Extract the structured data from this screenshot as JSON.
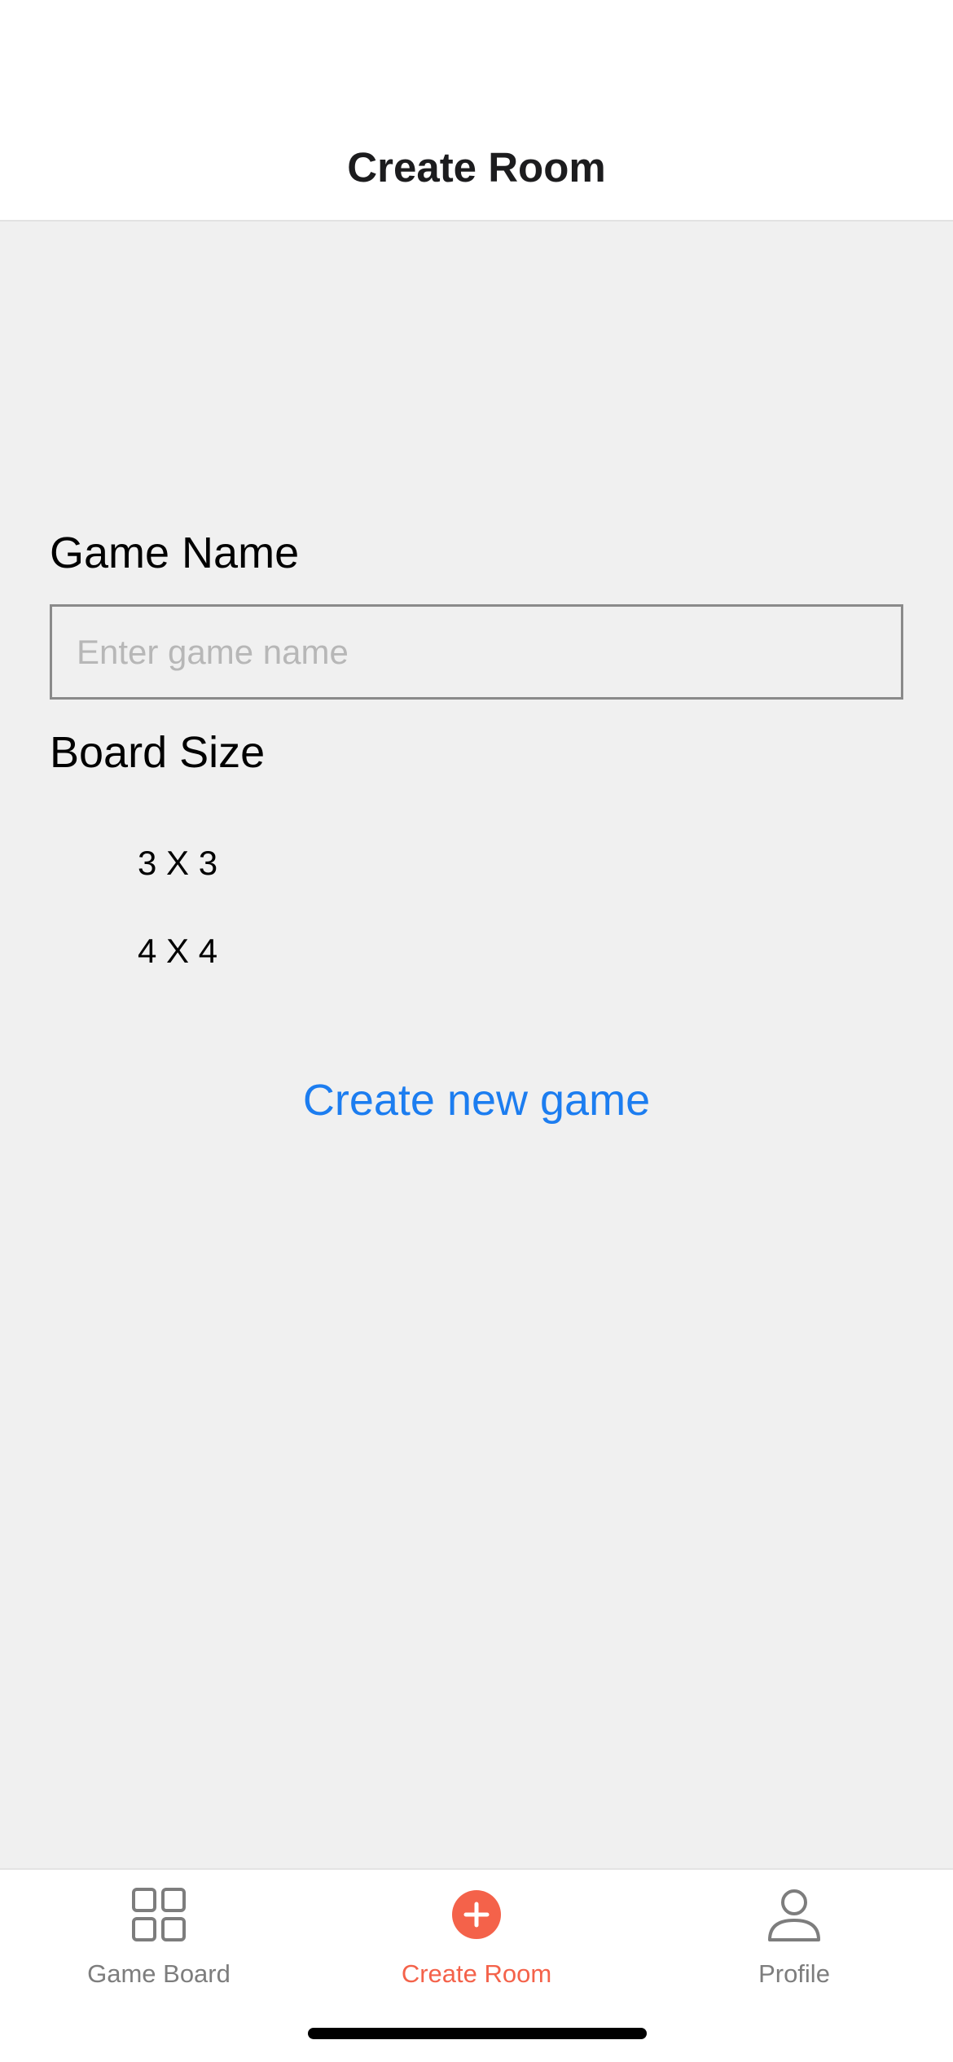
{
  "header": {
    "title": "Create Room"
  },
  "form": {
    "game_name_label": "Game Name",
    "game_name_value": "",
    "game_name_placeholder": "Enter game name",
    "board_size_label": "Board Size",
    "board_size_options": [
      "3 X 3",
      "4 X 4"
    ],
    "submit_label": "Create new game"
  },
  "tabbar": {
    "active_index": 1,
    "items": [
      {
        "label": "Game Board",
        "icon": "grid-icon"
      },
      {
        "label": "Create Room",
        "icon": "plus-circle-icon"
      },
      {
        "label": "Profile",
        "icon": "person-icon"
      }
    ]
  },
  "colors": {
    "accent": "#f4624a",
    "link": "#1c7df0",
    "inactive": "#7d7d7d",
    "background": "#f0f0f0"
  }
}
